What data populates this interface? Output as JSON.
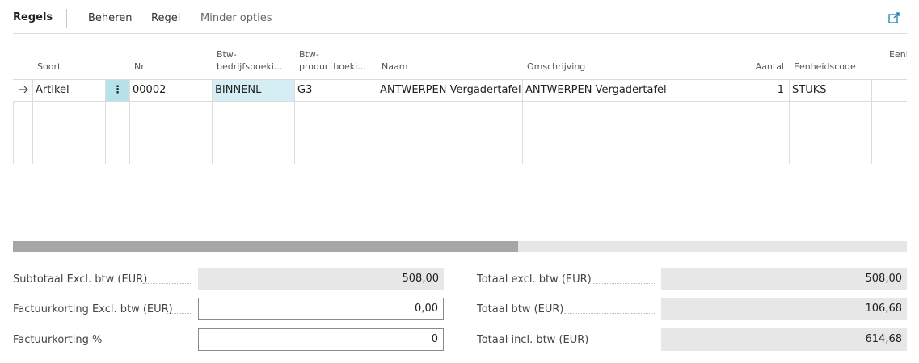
{
  "toolbar": {
    "title": "Regels",
    "actions": [
      "Beheren",
      "Regel",
      "Minder opties"
    ]
  },
  "grid": {
    "columns": [
      "Soort",
      "Nr.",
      "Btw-\nbedrijfsboeki...",
      "Btw-\nproductboeki...",
      "Naam",
      "Omschrijving",
      "Aantal",
      "Eenheidscode",
      "Eenl"
    ],
    "row": {
      "soort": "Artikel",
      "more": "⋮",
      "nr": "00002",
      "btw_bedrijf": "BINNENL",
      "btw_product": "G3",
      "naam": "ANTWERPEN Vergadertafel",
      "omschrijving": "ANTWERPEN Vergadertafel",
      "aantal": "1",
      "eenheid": "STUKS"
    }
  },
  "scrollbar": {
    "position_fraction": 0.565
  },
  "totals": {
    "left": [
      {
        "label": "Subtotaal Excl. btw (EUR)",
        "value": "508,00",
        "editable": false
      },
      {
        "label": "Factuurkorting Excl. btw (EUR)",
        "value": "0,00",
        "editable": true
      },
      {
        "label": "Factuurkorting %",
        "value": "0",
        "editable": true
      }
    ],
    "right": [
      {
        "label": "Totaal excl. btw (EUR)",
        "value": "508,00"
      },
      {
        "label": "Totaal btw (EUR)",
        "value": "106,68"
      },
      {
        "label": "Totaal incl. btw (EUR)",
        "value": "614,68"
      }
    ]
  },
  "colors": {
    "selected_cell": "#d5eef3",
    "action_cell": "#b8e2ea",
    "accent": "#0078a8"
  }
}
